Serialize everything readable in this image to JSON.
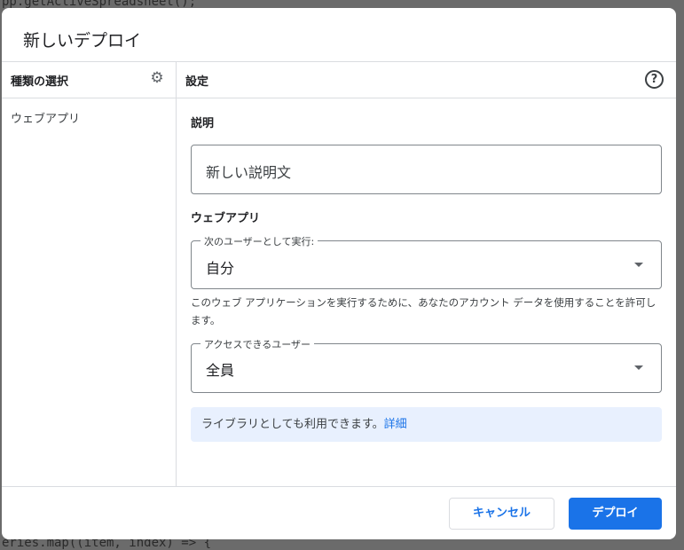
{
  "background_code": {
    "line1": "pp.getActiveSpreadsheet();",
    "line2": "eries.map((item, index) => {"
  },
  "dialog": {
    "title": "新しいデプロイ",
    "left_panel": {
      "header": "種類の選択",
      "gear_icon": "gear-icon",
      "items": [
        {
          "label": "ウェブアプリ"
        }
      ]
    },
    "right_panel": {
      "header": "設定",
      "help_icon": "help-circle-icon",
      "help_glyph": "?",
      "description": {
        "label": "説明",
        "value": "新しい説明文"
      },
      "section_title": "ウェブアプリ",
      "execute_as": {
        "legend": "次のユーザーとして実行:",
        "value": "自分"
      },
      "hint": "このウェブ アプリケーションを実行するために、あなたのアカウント データを使用することを許可します。",
      "access": {
        "legend": "アクセスできるユーザー",
        "value": "全員"
      },
      "info": {
        "text": "ライブラリとしても利用できます。",
        "link": "詳細"
      }
    },
    "footer": {
      "cancel_label": "キャンセル",
      "deploy_label": "デプロイ"
    }
  },
  "colors": {
    "accent": "#1a73e8",
    "info_bg": "#e8f0fe"
  }
}
